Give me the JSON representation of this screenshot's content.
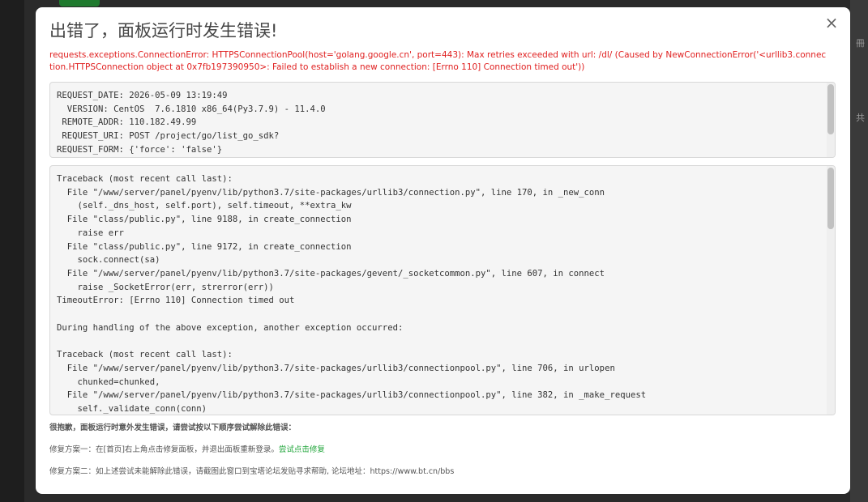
{
  "background": {
    "right_glyphs": [
      "冊",
      "共"
    ]
  },
  "dialog": {
    "title": "出错了，面板运行时发生错误!",
    "close_icon": "×",
    "error_message": "requests.exceptions.ConnectionError: HTTPSConnectionPool(host='golang.google.cn', port=443): Max retries exceeded with url: /dl/ (Caused by NewConnectionError('<urllib3.connection.HTTPSConnection object at 0x7fb197390950>: Failed to establish a new connection: [Errno 110] Connection timed out'))",
    "request_info": "REQUEST_DATE: 2026-05-09 13:19:49\n  VERSION: CentOS  7.6.1810 x86_64(Py3.7.9) - 11.4.0\n REMOTE_ADDR: 110.182.49.99\n REQUEST_URI: POST /project/go/list_go_sdk?\nREQUEST_FORM: {'force': 'false'}",
    "traceback": "Traceback (most recent call last):\n  File \"/www/server/panel/pyenv/lib/python3.7/site-packages/urllib3/connection.py\", line 170, in _new_conn\n    (self._dns_host, self.port), self.timeout, **extra_kw\n  File \"class/public.py\", line 9188, in create_connection\n    raise err\n  File \"class/public.py\", line 9172, in create_connection\n    sock.connect(sa)\n  File \"/www/server/panel/pyenv/lib/python3.7/site-packages/gevent/_socketcommon.py\", line 607, in connect\n    raise _SocketError(err, strerror(err))\nTimeoutError: [Errno 110] Connection timed out\n\nDuring handling of the above exception, another exception occurred:\n\nTraceback (most recent call last):\n  File \"/www/server/panel/pyenv/lib/python3.7/site-packages/urllib3/connectionpool.py\", line 706, in urlopen\n    chunked=chunked,\n  File \"/www/server/panel/pyenv/lib/python3.7/site-packages/urllib3/connectionpool.py\", line 382, in _make_request\n    self._validate_conn(conn)",
    "notice": "很抱歉，面板运行时意外发生错误，请尝试按以下顺序尝试解除此错误：",
    "fix1_text": "修复方案一：在[首页]右上角点击修复面板，并退出面板重新登录。",
    "fix1_link": "尝试点击修复",
    "fix2_text": "修复方案二：如上述尝试未能解除此错误，请截图此窗口到宝塔论坛发贴寻求帮助, 论坛地址：https://www.bt.cn/bbs",
    "link_color": "#20a53a",
    "error_color": "#e02020"
  }
}
